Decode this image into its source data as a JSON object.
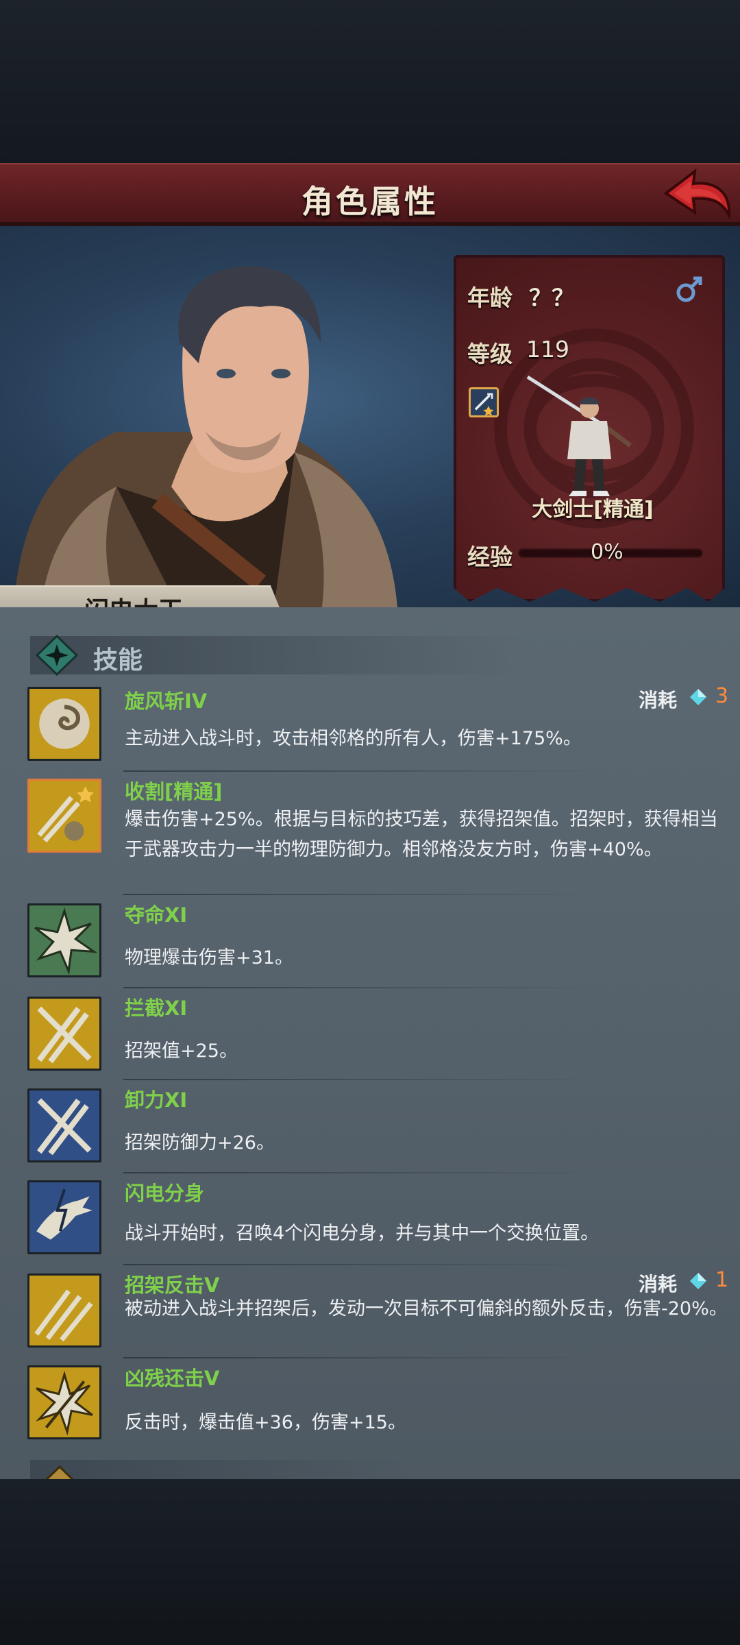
{
  "header": {
    "title": "角色属性"
  },
  "character": {
    "name": "闪电大王",
    "age_label": "年龄",
    "age_value": "？？",
    "level_label": "等级",
    "level_value": "119",
    "class_name": "大剑士[精通]",
    "exp_label": "经验",
    "exp_value": "0%",
    "exp_fraction": 0.0
  },
  "skills_section": {
    "title": "技能"
  },
  "skills": [
    {
      "name": "旋风斩IV",
      "desc": "主动进入战斗时，攻击相邻格的所有人，伤害+175%。",
      "cost_label": "消耗",
      "cost_value": "3",
      "icon": "whirlwind-icon"
    },
    {
      "name": "收割[精通]",
      "desc": "爆击伤害+25%。根据与目标的技巧差，获得招架值。招架时，获得相当于武器攻击力一半的物理防御力。相邻格没友方时，伤害+40%。",
      "icon": "harvest-icon"
    },
    {
      "name": "夺命XI",
      "desc": "物理爆击伤害+31。",
      "icon": "burst-icon"
    },
    {
      "name": "拦截XI",
      "desc": "招架值+25。",
      "icon": "crossed-swords-icon"
    },
    {
      "name": "卸力XI",
      "desc": "招架防御力+26。",
      "icon": "crossed-swords-blue-icon"
    },
    {
      "name": "闪电分身",
      "desc": "战斗开始时，召唤4个闪电分身，并与其中一个交换位置。",
      "icon": "lightning-clone-icon"
    },
    {
      "name": "招架反击V",
      "desc": "被动进入战斗并招架后，发动一次目标不可偏斜的额外反击，伤害-20%。",
      "cost_label": "消耗",
      "cost_value": "1",
      "icon": "counter-icon"
    },
    {
      "name": "凶残还击V",
      "desc": "反击时，爆击值+36，伤害+15。",
      "icon": "brutal-strike-icon"
    }
  ],
  "colors": {
    "skill_name": "#7fd04a",
    "cost_value": "#ff8a3a",
    "title_bar": "#5a1c20"
  }
}
